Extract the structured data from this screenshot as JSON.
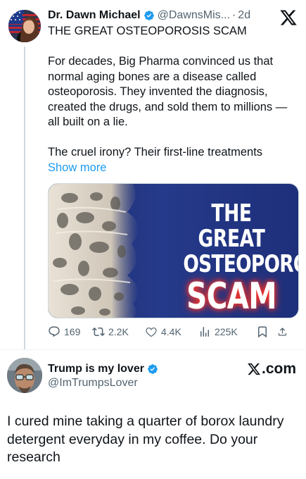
{
  "post": {
    "author_name": "Dr. Dawn Michael",
    "handle": "@DawnsMis...",
    "separator": "·",
    "time": "2d",
    "headline": "THE GREAT OSTEOPOROSIS SCAM",
    "paragraph1": "For decades, Big Pharma convinced us that normal aging bones are a disease called osteoporosis. They invented the diagnosis, created the drugs, and sold them to millions — all built on a lie.",
    "paragraph2": "The cruel irony? Their first-line treatments",
    "show_more": "Show more",
    "media": {
      "line1": "THE GREAT",
      "line2": "OSTEOPOROSIS",
      "line3": "SCAM"
    },
    "actions": {
      "replies": "169",
      "reposts": "2.2K",
      "likes": "4.4K",
      "views": "225K"
    }
  },
  "reply": {
    "author_name": "Trump is my lover",
    "handle": "@ImTrumpsLover",
    "watermark": ".com",
    "text": "I cured mine taking a quarter of borox laundry detergent  everyday in my coffee. Do your research"
  },
  "colors": {
    "verified": "#1d9bf0",
    "link": "#1d9bf0",
    "secondary_text": "#536471",
    "primary_text": "#0f1419",
    "media_background": "#253a8a",
    "scam_glow": "#ff3b2f"
  },
  "icons": [
    "verified-badge-icon",
    "x-logo-icon",
    "reply-icon",
    "repost-icon",
    "like-icon",
    "views-icon",
    "bookmark-icon",
    "share-icon"
  ]
}
